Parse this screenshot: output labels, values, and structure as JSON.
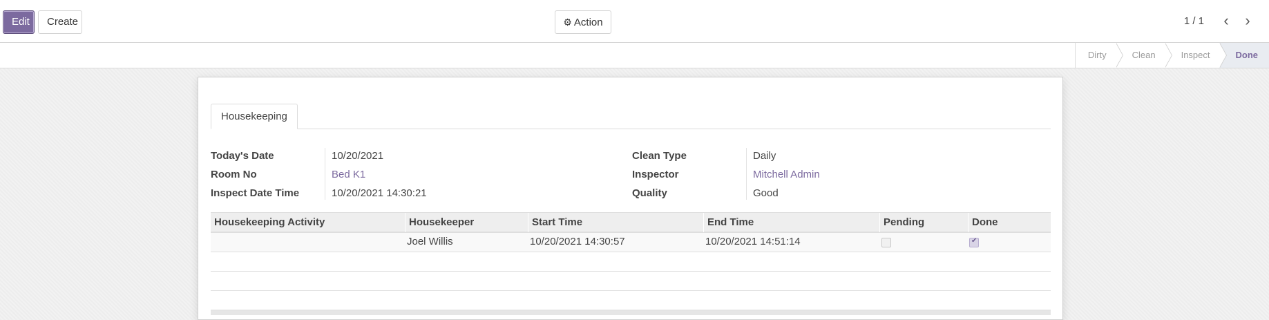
{
  "toolbar": {
    "edit_label": "Edit",
    "create_label": "Create",
    "action_label": "Action",
    "action_icon": "gear-icon"
  },
  "pager": {
    "value": "1 / 1",
    "prev_icon": "chevron-left-icon",
    "next_icon": "chevron-right-icon"
  },
  "statusbar": {
    "steps": [
      {
        "label": "Dirty",
        "active": false
      },
      {
        "label": "Clean",
        "active": false
      },
      {
        "label": "Inspect",
        "active": false
      },
      {
        "label": "Done",
        "active": true
      }
    ]
  },
  "form": {
    "tab_label": "Housekeeping",
    "left_fields": [
      {
        "label": "Today's Date",
        "value": "10/20/2021"
      },
      {
        "label": "Room No",
        "value": "Bed K1"
      },
      {
        "label": "Inspect Date Time",
        "value": "10/20/2021 14:30:21"
      }
    ],
    "right_fields": [
      {
        "label": "Clean Type",
        "value": "Daily"
      },
      {
        "label": "Inspector",
        "value": "Mitchell Admin"
      },
      {
        "label": "Quality",
        "value": "Good"
      }
    ]
  },
  "grid": {
    "columns": [
      "Housekeeping Activity",
      "Housekeeper",
      "Start Time",
      "End Time",
      "Pending",
      "Done"
    ],
    "rows": [
      {
        "activity": "",
        "housekeeper": "Joel Willis",
        "start": "10/20/2021 14:30:57",
        "end": "10/20/2021 14:51:14",
        "pending": false,
        "done": true
      }
    ]
  },
  "colors": {
    "primary": "#7c6a9f",
    "link": "#7c6a9f"
  }
}
